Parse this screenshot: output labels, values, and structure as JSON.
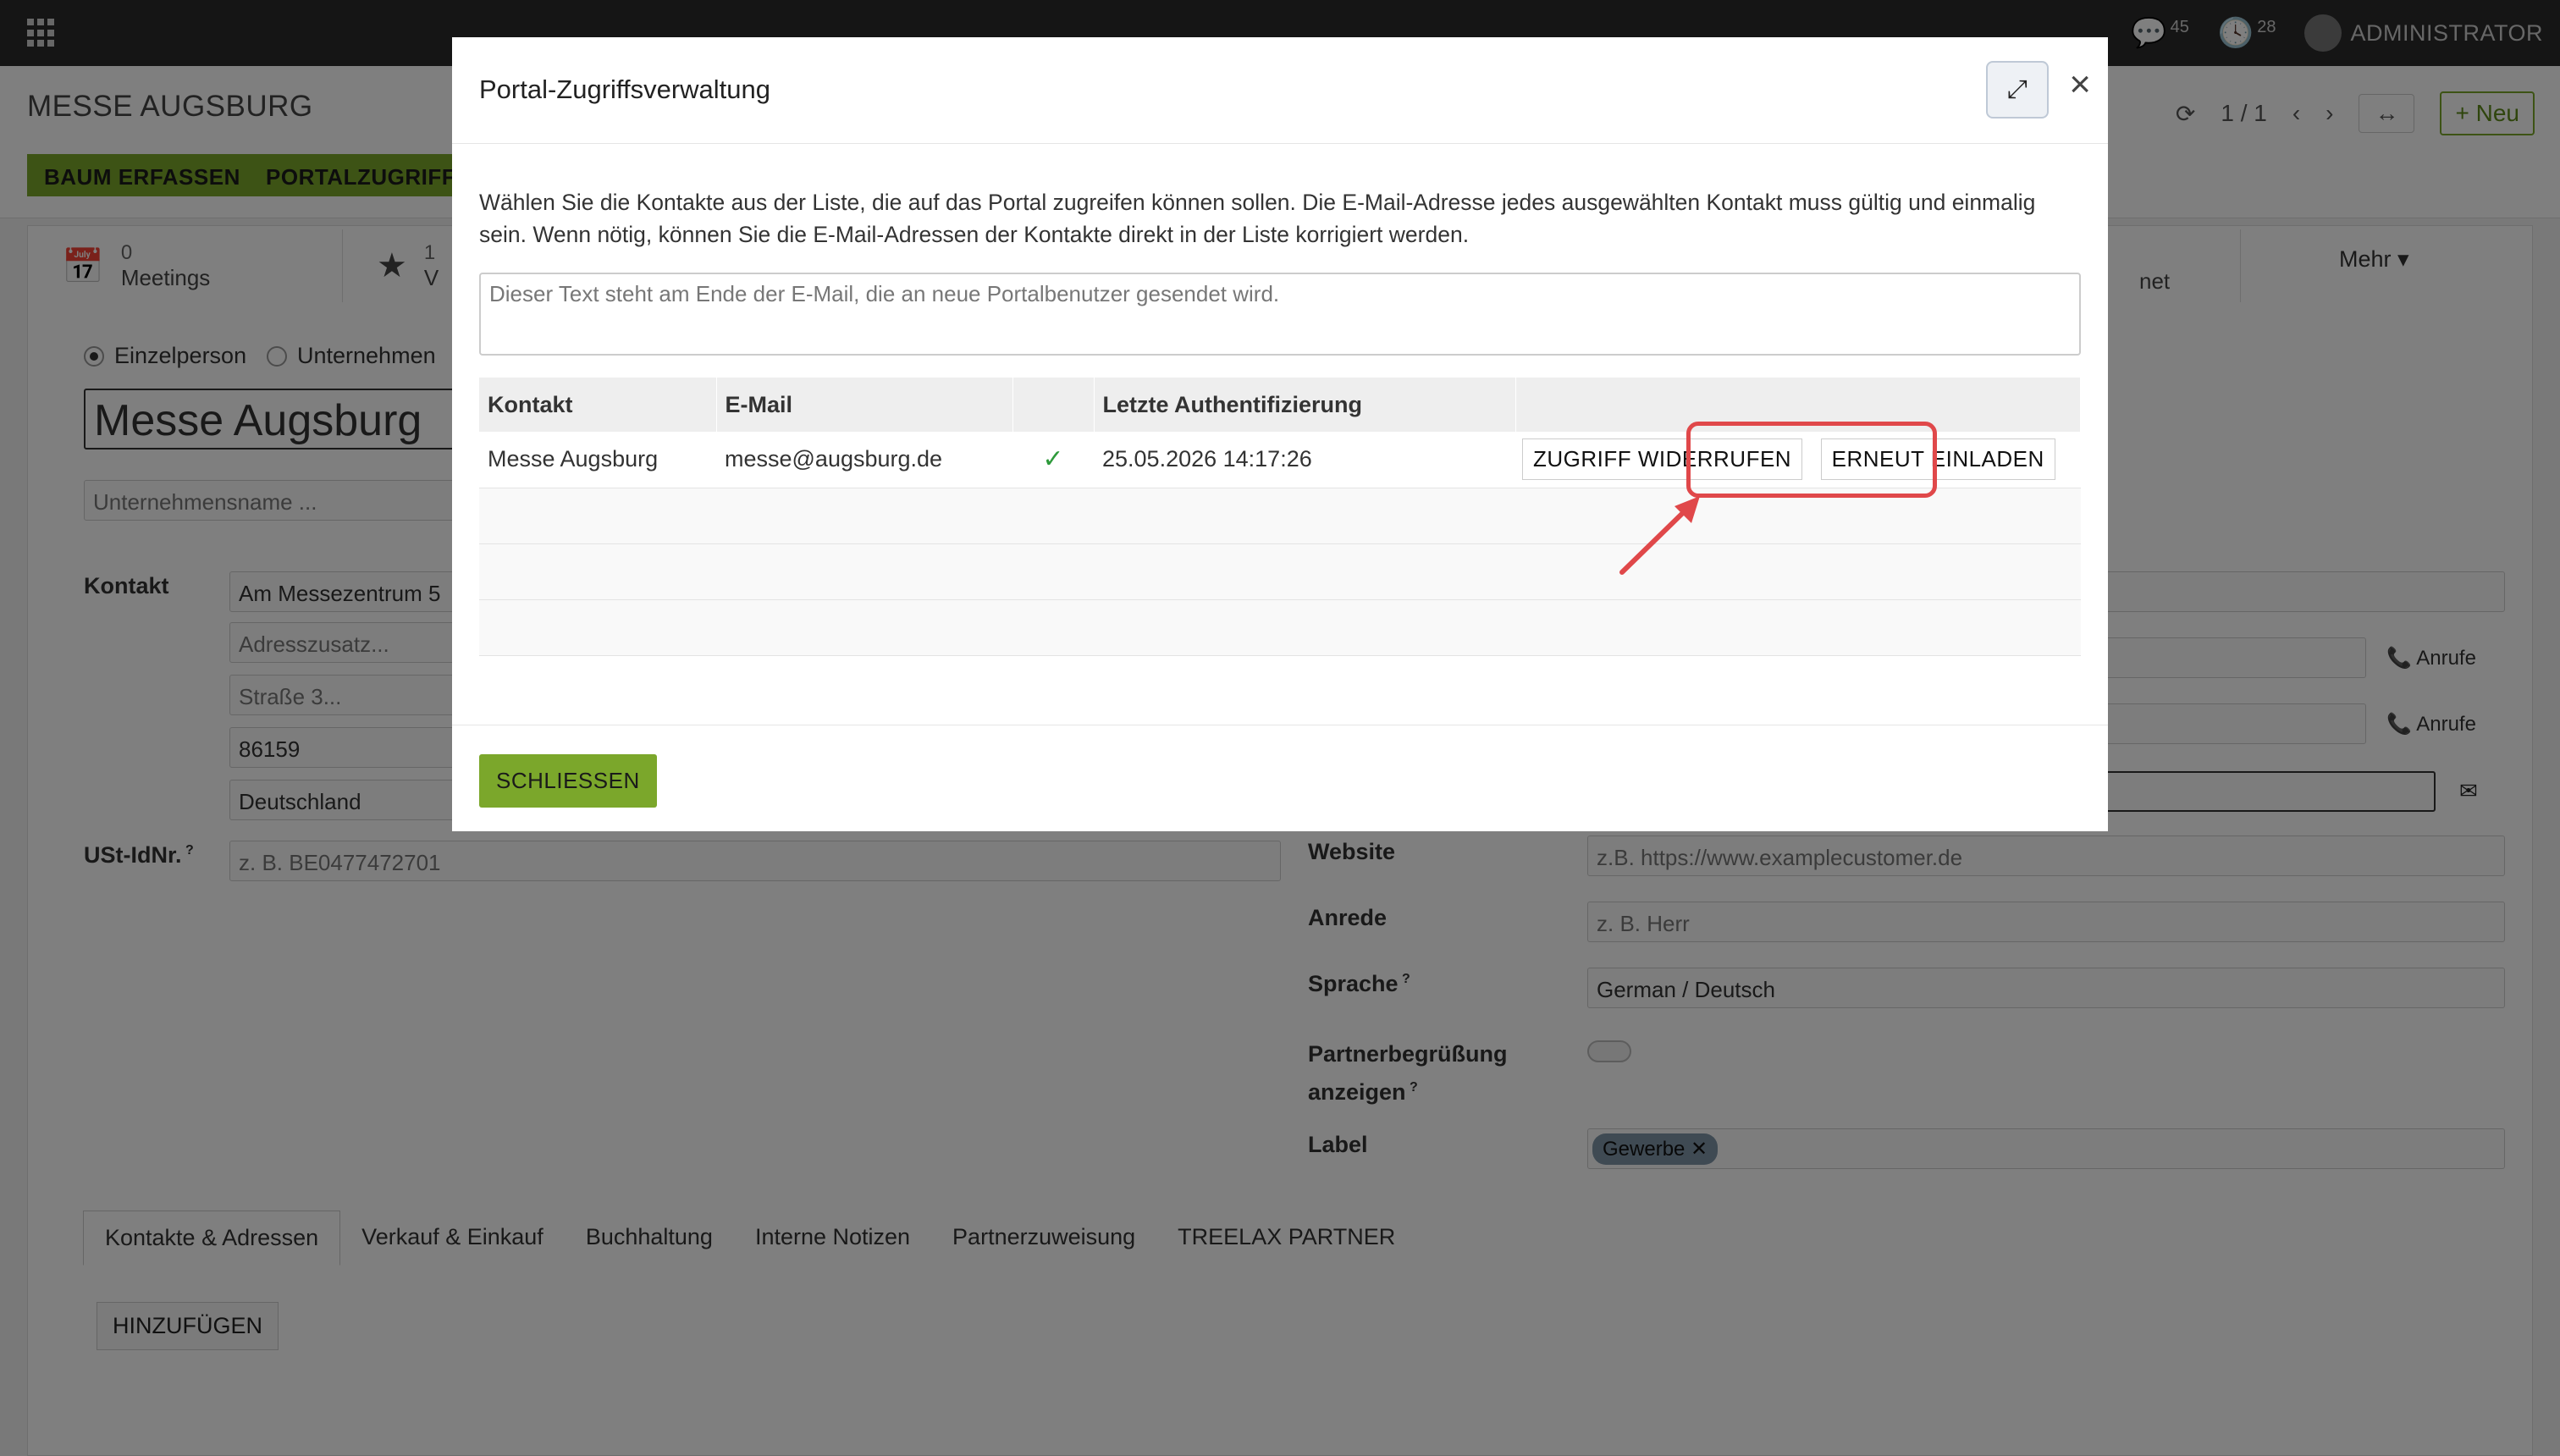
{
  "navbar": {
    "messages_count": "45",
    "activities_count": "28",
    "user": "ADMINISTRATOR"
  },
  "control": {
    "breadcrumb": "MESSE AUGSBURG",
    "actions": [
      "BAUM ERFASSEN",
      "PORTALZUGRIFF"
    ],
    "pager": "1 / 1",
    "new_label": "Neu"
  },
  "form": {
    "stats": [
      {
        "num": "0",
        "label": "Meetings"
      },
      {
        "num": "1",
        "label": "V"
      }
    ],
    "stat_more": "Mehr",
    "stat_partial": "net",
    "company_type": {
      "person": "Einzelperson",
      "company": "Unternehmen"
    },
    "name": "Messe Augsburg",
    "company_placeholder": "Unternehmensname ...",
    "contact_label": "Kontakt",
    "street": "Am Messezentrum 5",
    "street2_placeholder": "Adresszusatz...",
    "street3_placeholder": "Straße 3...",
    "zip": "86159",
    "country": "Deutschland",
    "vat_label": "USt-IdNr.",
    "vat_placeholder": "z. B. BE0477472701",
    "calls_label": "Anrufe",
    "website_label": "Website",
    "website_placeholder": "z.B. https://www.examplecustomer.de",
    "title_label": "Anrede",
    "title_placeholder": "z. B. Herr",
    "lang_label": "Sprache",
    "lang_value": "German / Deutsch",
    "greeting_label_1": "Partnerbegrüßung",
    "greeting_label_2": "anzeigen",
    "tag_label": "Label",
    "tag_value": "Gewerbe",
    "tabs": [
      "Kontakte & Adressen",
      "Verkauf & Einkauf",
      "Buchhaltung",
      "Interne Notizen",
      "Partnerzuweisung",
      "TREELAX PARTNER"
    ],
    "add_label": "HINZUFÜGEN"
  },
  "modal": {
    "title": "Portal-Zugriffsverwaltung",
    "intro": "Wählen Sie die Kontakte aus der Liste, die auf das Portal zugreifen können sollen. Die E-Mail-Adresse jedes ausgewählten Kontakt muss gültig und einmalig sein. Wenn nötig, können Sie die E-Mail-Adressen der Kontakte direkt in der Liste korrigiert werden.",
    "welcome_placeholder": "Dieser Text steht am Ende der E-Mail, die an neue Portalbenutzer gesendet wird.",
    "columns": {
      "contact": "Kontakt",
      "email": "E-Mail",
      "last_auth": "Letzte Authentifizierung"
    },
    "rows": [
      {
        "contact": "Messe Augsburg",
        "email": "messe@augsburg.de",
        "last_auth": "25.05.2026 14:17:26"
      }
    ],
    "revoke_label": "ZUGRIFF WIDERRUFEN",
    "reinvite_label": "ERNEUT EINLADEN",
    "close_label": "SCHLIESSEN"
  }
}
